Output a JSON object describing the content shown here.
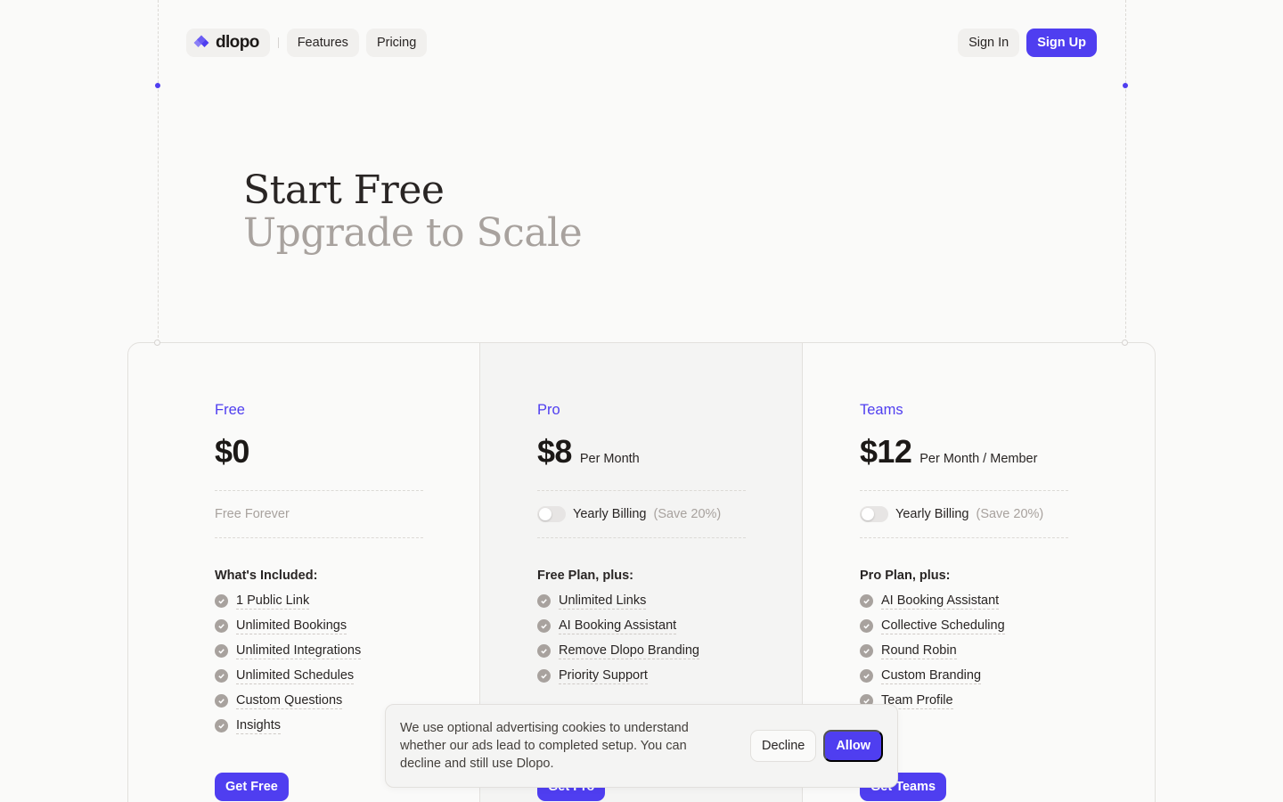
{
  "header": {
    "logo_text": "dlopo",
    "nav": [
      "Features",
      "Pricing"
    ],
    "sign_in": "Sign In",
    "sign_up": "Sign Up"
  },
  "hero": {
    "line1": "Start Free",
    "line2": "Upgrade to Scale"
  },
  "plans": [
    {
      "name": "Free",
      "price": "$0",
      "price_note": "",
      "billing_text": "Free Forever",
      "included_title": "What's Included:",
      "features": [
        "1 Public Link",
        "Unlimited Bookings",
        "Unlimited Integrations",
        "Unlimited Schedules",
        "Custom Questions",
        "Insights"
      ],
      "cta": "Get Free"
    },
    {
      "name": "Pro",
      "price": "$8",
      "price_note": "Per Month",
      "billing_label": "Yearly Billing",
      "billing_save": "(Save 20%)",
      "yearly_enabled": false,
      "included_title": "Free Plan, plus:",
      "features": [
        "Unlimited Links",
        "AI Booking Assistant",
        "Remove Dlopo Branding",
        "Priority Support"
      ],
      "cta": "Get Pro"
    },
    {
      "name": "Teams",
      "price": "$12",
      "price_note": "Per Month / Member",
      "billing_label": "Yearly Billing",
      "billing_save": "(Save 20%)",
      "yearly_enabled": false,
      "included_title": "Pro Plan, plus:",
      "features": [
        "AI Booking Assistant",
        "Collective Scheduling",
        "Round Robin",
        "Custom Branding",
        "Team Profile"
      ],
      "cta": "Get Teams"
    }
  ],
  "cookie_banner": {
    "text": "We use optional advertising cookies to understand whether our ads lead to completed setup. You can decline and still use Dlopo.",
    "decline": "Decline",
    "allow": "Allow"
  },
  "colors": {
    "accent": "#4f3ef0",
    "background": "#fafaf9",
    "muted_text": "#a8a29e"
  },
  "icons": {
    "logo": "diamond-logo-icon",
    "feature": "check-circle-icon"
  }
}
